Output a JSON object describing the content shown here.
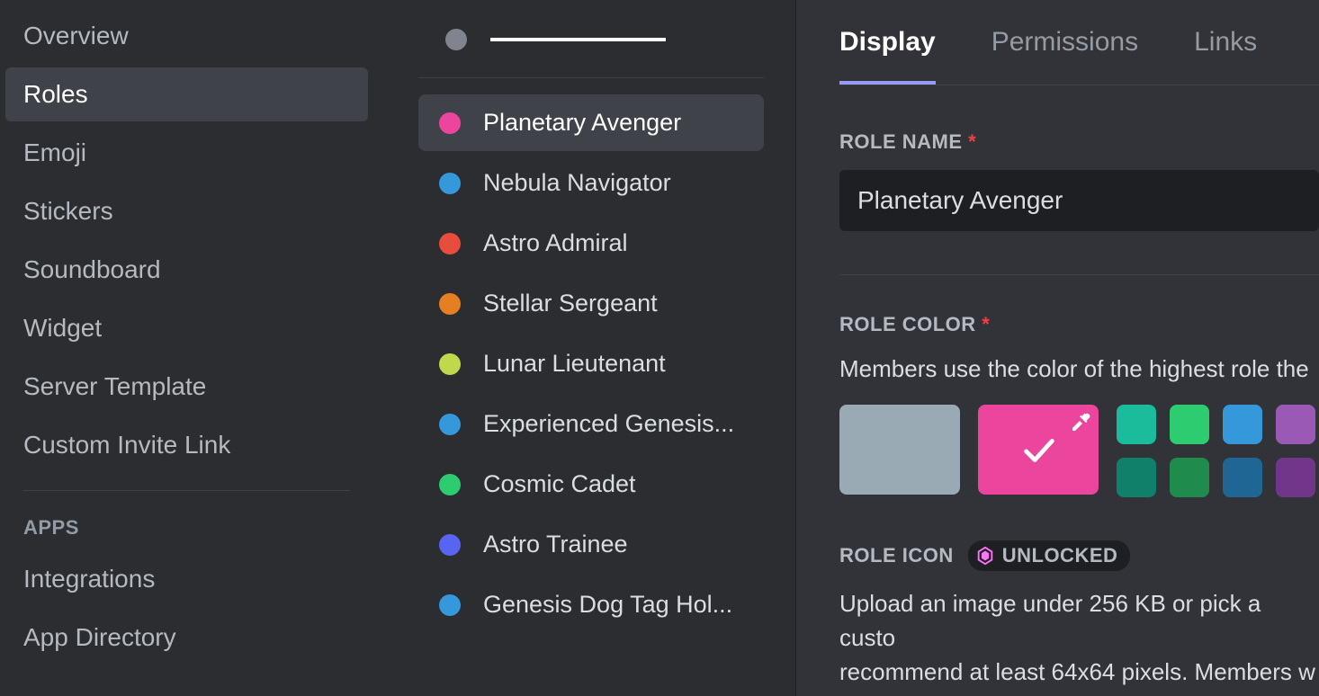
{
  "sidebar": {
    "items": [
      {
        "label": "Overview",
        "selected": false
      },
      {
        "label": "Roles",
        "selected": true
      },
      {
        "label": "Emoji",
        "selected": false
      },
      {
        "label": "Stickers",
        "selected": false
      },
      {
        "label": "Soundboard",
        "selected": false
      },
      {
        "label": "Widget",
        "selected": false
      },
      {
        "label": "Server Template",
        "selected": false
      },
      {
        "label": "Custom Invite Link",
        "selected": false
      }
    ],
    "apps_header": "APPS",
    "apps_items": [
      {
        "label": "Integrations"
      },
      {
        "label": "App Directory"
      }
    ]
  },
  "roles": [
    {
      "name": "Planetary Avenger",
      "color": "#eb459e",
      "selected": true
    },
    {
      "name": "Nebula Navigator",
      "color": "#3498db",
      "selected": false
    },
    {
      "name": "Astro Admiral",
      "color": "#e74c3c",
      "selected": false
    },
    {
      "name": "Stellar Sergeant",
      "color": "#e67e22",
      "selected": false
    },
    {
      "name": "Lunar Lieutenant",
      "color": "#c0d94c",
      "selected": false
    },
    {
      "name": "Experienced Genesis...",
      "color": "#3498db",
      "selected": false
    },
    {
      "name": "Cosmic Cadet",
      "color": "#2ecc71",
      "selected": false
    },
    {
      "name": "Astro Trainee",
      "color": "#5865f2",
      "selected": false
    },
    {
      "name": "Genesis Dog Tag Hol...",
      "color": "#3498db",
      "selected": false
    }
  ],
  "tabs": [
    {
      "label": "Display",
      "active": true
    },
    {
      "label": "Permissions",
      "active": false
    },
    {
      "label": "Links",
      "active": false
    }
  ],
  "display": {
    "role_name_label": "ROLE NAME",
    "role_name_value": "Planetary Avenger",
    "role_color_label": "ROLE COLOR",
    "role_color_help": "Members use the color of the highest role the",
    "selected_color": "#eb459e",
    "color_swatches_row1": [
      "#1abc9c",
      "#2ecc71",
      "#3498db",
      "#9b59b6"
    ],
    "color_swatches_row2": [
      "#11806a",
      "#1f8b4c",
      "#206694",
      "#71368a"
    ],
    "role_icon_label": "ROLE ICON",
    "unlocked_label": "UNLOCKED",
    "role_icon_help1": "Upload an image under 256 KB or pick a custo",
    "role_icon_help2": "recommend at least 64x64 pixels. Members w"
  }
}
